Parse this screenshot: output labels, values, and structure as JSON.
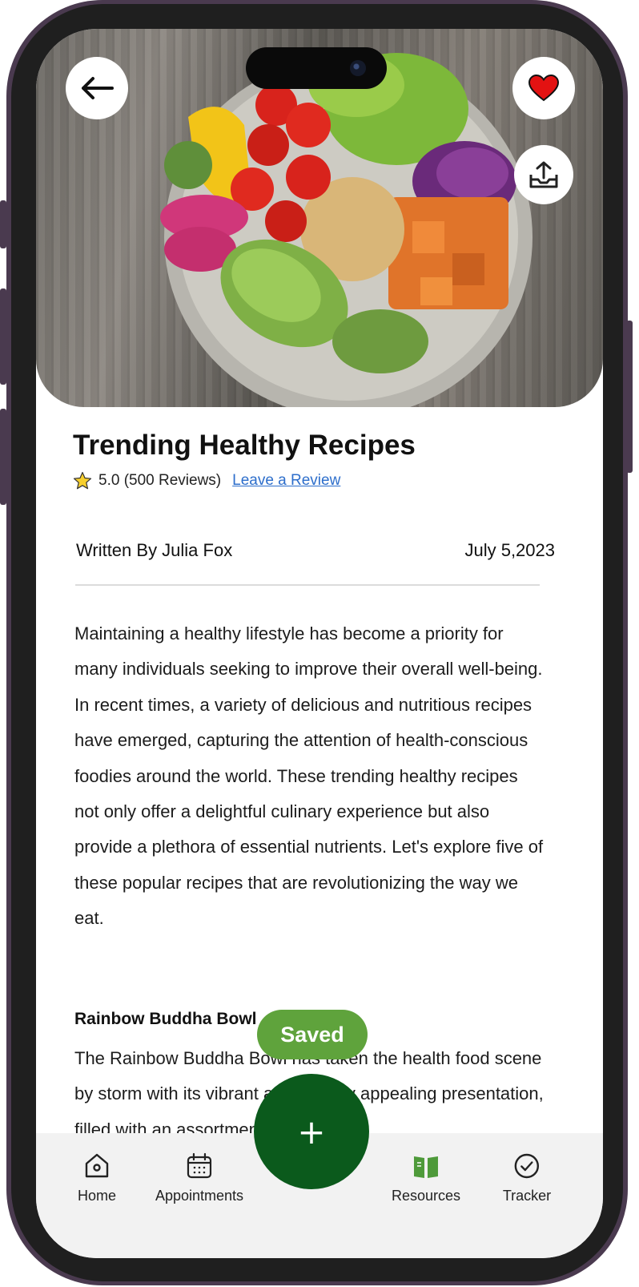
{
  "header": {
    "back_icon": "arrow-left-icon",
    "favorite_icon": "heart-icon",
    "share_icon": "share-tray-icon",
    "favorite_color": "#e31212"
  },
  "article": {
    "title": "Trending Healthy Recipes",
    "rating_icon": "star-icon",
    "rating_text": "5.0 (500 Reviews)",
    "review_link": "Leave a Review",
    "author": "Written By Julia Fox",
    "date": "July 5,2023",
    "intro": "Maintaining a healthy lifestyle has become a priority for many individuals seeking to improve their overall well-being. In recent times, a variety of delicious and nutritious recipes have emerged, capturing the attention of health-conscious foodies around the world. These trending healthy recipes not only offer a delightful culinary experience but also provide a plethora of essential nutrients. Let's explore five of these popular recipes that are revolutionizing the way we eat.",
    "section_title": "Rainbow Buddha Bowl",
    "section_text": "The Rainbow Buddha Bowl has taken the health food scene by storm with its vibrant and visually appealing presentation, filled with an assortment"
  },
  "toast": {
    "label": "Saved"
  },
  "fab": {
    "label": "+"
  },
  "nav": {
    "items": [
      {
        "label": "Home",
        "icon": "home-icon"
      },
      {
        "label": "Appointments",
        "icon": "calendar-icon"
      },
      {
        "label": "Resources",
        "icon": "book-icon",
        "active": true
      },
      {
        "label": "Tracker",
        "icon": "check-circle-icon"
      }
    ]
  },
  "colors": {
    "accent": "#0b5a1c",
    "toast": "#5fa33c",
    "link": "#2d6ecb",
    "active_nav_icon": "#4e9a3a"
  }
}
